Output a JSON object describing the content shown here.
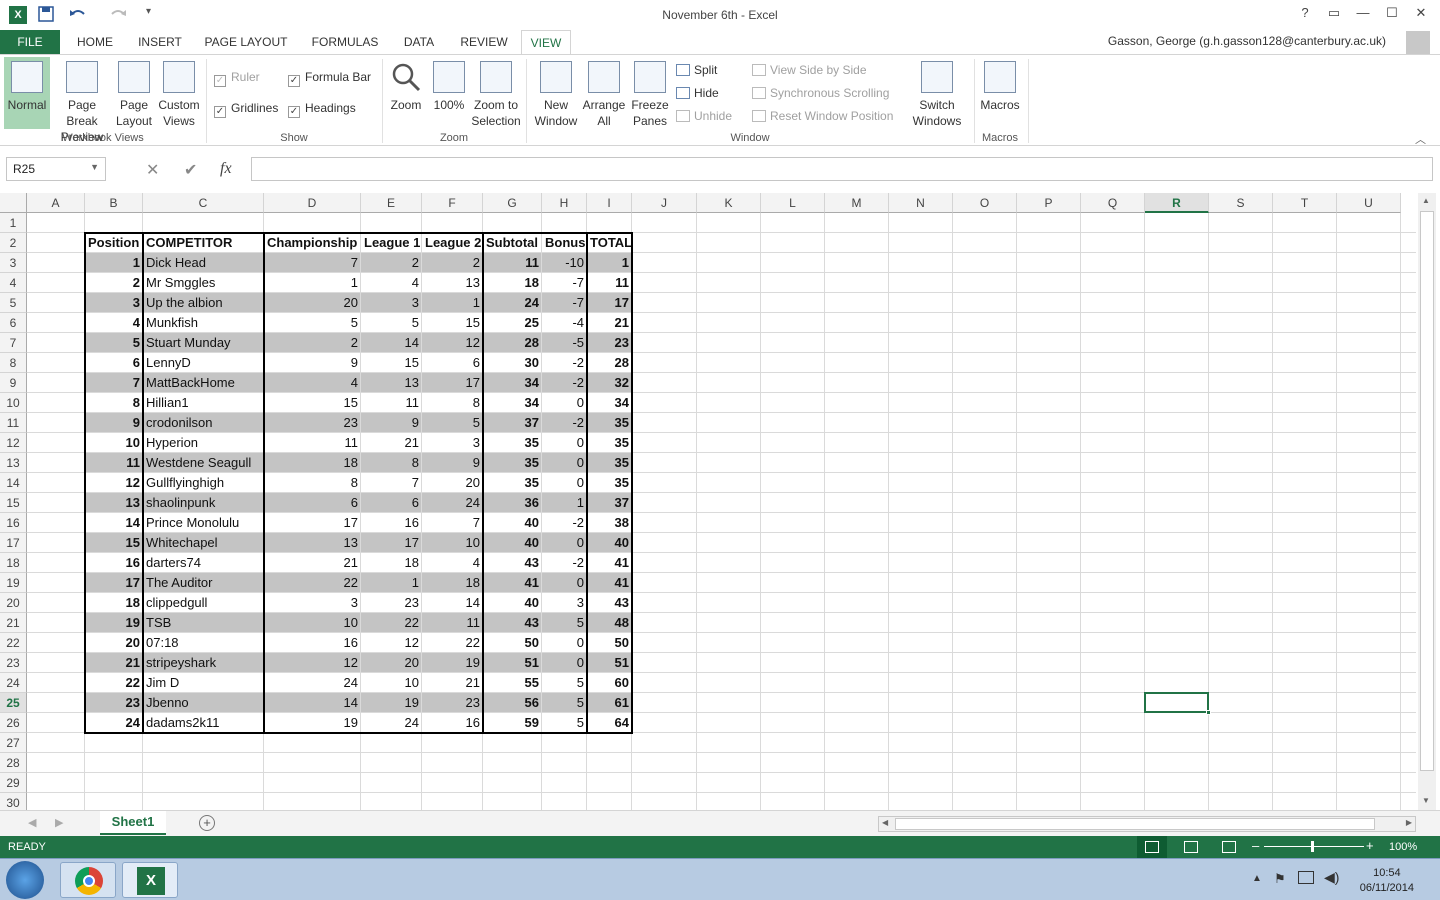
{
  "app": {
    "title": "November 6th - Excel",
    "icon_label": "X"
  },
  "qat": {
    "save": "save-icon",
    "undo": "undo-icon",
    "redo": "redo-icon",
    "customize": "customize-icon"
  },
  "window": {
    "help": "?",
    "ribbon_opts": "▭",
    "minimize": "—",
    "maximize": "☐",
    "close": "✕"
  },
  "tabs": [
    "FILE",
    "HOME",
    "INSERT",
    "PAGE LAYOUT",
    "FORMULAS",
    "DATA",
    "REVIEW",
    "VIEW"
  ],
  "user": "Gasson, George (g.h.gasson128@canterbury.ac.uk)",
  "ribbon": {
    "workbook_views": {
      "label": "Workbook Views",
      "normal": "Normal",
      "page_break": "Page Break Preview",
      "page_layout": "Page Layout",
      "custom_views": "Custom Views"
    },
    "show": {
      "label": "Show",
      "ruler": "Ruler",
      "formula_bar": "Formula Bar",
      "gridlines": "Gridlines",
      "headings": "Headings"
    },
    "zoom": {
      "label": "Zoom",
      "zoom": "Zoom",
      "hundred": "100%",
      "zoom_sel": "Zoom to Selection"
    },
    "window": {
      "label": "Window",
      "new_window": "New Window",
      "arrange_all": "Arrange All",
      "freeze": "Freeze Panes",
      "split": "Split",
      "hide": "Hide",
      "unhide": "Unhide",
      "side_by_side": "View Side by Side",
      "sync_scroll": "Synchronous Scrolling",
      "reset_pos": "Reset Window Position",
      "switch": "Switch Windows"
    },
    "macros": {
      "label": "Macros",
      "macros": "Macros"
    }
  },
  "formula_bar": {
    "name_box": "R25",
    "cancel": "✕",
    "enter": "✔",
    "fx": "fx",
    "value": ""
  },
  "columns": [
    "A",
    "B",
    "C",
    "D",
    "E",
    "F",
    "G",
    "H",
    "I",
    "J",
    "K",
    "L",
    "M",
    "N",
    "O",
    "P",
    "Q",
    "R",
    "S",
    "T",
    "U"
  ],
  "rows": [
    "1",
    "2",
    "3",
    "4",
    "5",
    "6",
    "7",
    "8",
    "9",
    "10",
    "11",
    "12",
    "13",
    "14",
    "15",
    "16",
    "17",
    "18",
    "19",
    "20",
    "21",
    "22",
    "23",
    "24",
    "25",
    "26",
    "27",
    "28",
    "29",
    "30"
  ],
  "table": {
    "headers": [
      "Position",
      "COMPETITOR",
      "Championship",
      "League 1",
      "League 2",
      "Subtotal",
      "Bonus",
      "TOTAL"
    ],
    "rows": [
      [
        "1",
        "Dick Head",
        "7",
        "2",
        "2",
        "11",
        "-10",
        "1"
      ],
      [
        "2",
        "Mr Smggles",
        "1",
        "4",
        "13",
        "18",
        "-7",
        "11"
      ],
      [
        "3",
        "Up the albion",
        "20",
        "3",
        "1",
        "24",
        "-7",
        "17"
      ],
      [
        "4",
        "Munkfish",
        "5",
        "5",
        "15",
        "25",
        "-4",
        "21"
      ],
      [
        "5",
        "Stuart Munday",
        "2",
        "14",
        "12",
        "28",
        "-5",
        "23"
      ],
      [
        "6",
        "LennyD",
        "9",
        "15",
        "6",
        "30",
        "-2",
        "28"
      ],
      [
        "7",
        "MattBackHome",
        "4",
        "13",
        "17",
        "34",
        "-2",
        "32"
      ],
      [
        "8",
        "Hillian1",
        "15",
        "11",
        "8",
        "34",
        "0",
        "34"
      ],
      [
        "9",
        "crodonilson",
        "23",
        "9",
        "5",
        "37",
        "-2",
        "35"
      ],
      [
        "10",
        "Hyperion",
        "11",
        "21",
        "3",
        "35",
        "0",
        "35"
      ],
      [
        "11",
        "Westdene Seagull",
        "18",
        "8",
        "9",
        "35",
        "0",
        "35"
      ],
      [
        "12",
        "Gullflyinghigh",
        "8",
        "7",
        "20",
        "35",
        "0",
        "35"
      ],
      [
        "13",
        "shaolinpunk",
        "6",
        "6",
        "24",
        "36",
        "1",
        "37"
      ],
      [
        "14",
        "Prince Monolulu",
        "17",
        "16",
        "7",
        "40",
        "-2",
        "38"
      ],
      [
        "15",
        "Whitechapel",
        "13",
        "17",
        "10",
        "40",
        "0",
        "40"
      ],
      [
        "16",
        "darters74",
        "21",
        "18",
        "4",
        "43",
        "-2",
        "41"
      ],
      [
        "17",
        "The Auditor",
        "22",
        "1",
        "18",
        "41",
        "0",
        "41"
      ],
      [
        "18",
        "clippedgull",
        "3",
        "23",
        "14",
        "40",
        "3",
        "43"
      ],
      [
        "19",
        "TSB",
        "10",
        "22",
        "11",
        "43",
        "5",
        "48"
      ],
      [
        "20",
        "07:18",
        "16",
        "12",
        "22",
        "50",
        "0",
        "50"
      ],
      [
        "21",
        "stripeyshark",
        "12",
        "20",
        "19",
        "51",
        "0",
        "51"
      ],
      [
        "22",
        "Jim D",
        "24",
        "10",
        "21",
        "55",
        "5",
        "60"
      ],
      [
        "23",
        "Jbenno",
        "14",
        "19",
        "23",
        "56",
        "5",
        "61"
      ],
      [
        "24",
        "dadams2k11",
        "19",
        "24",
        "16",
        "59",
        "5",
        "64"
      ]
    ]
  },
  "sheet": {
    "tab": "Sheet1",
    "add": "+"
  },
  "status": {
    "mode": "READY",
    "zoom": "100%"
  },
  "taskbar": {
    "time": "10:54",
    "date": "06/11/2014"
  }
}
